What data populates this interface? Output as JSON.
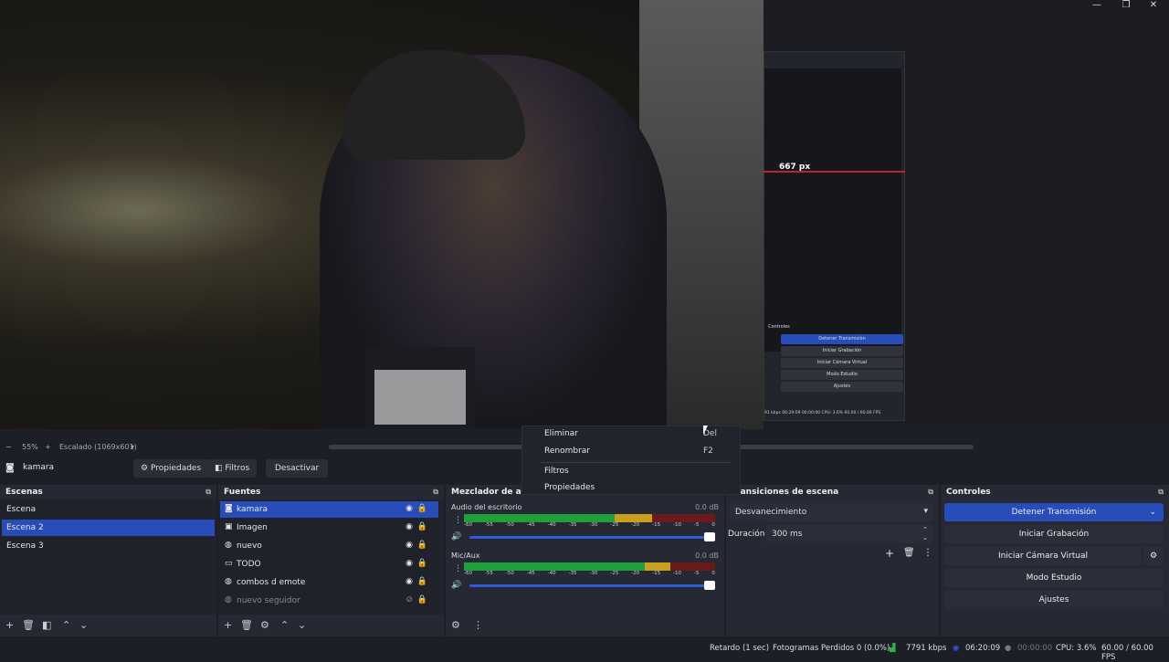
{
  "colors": {
    "accent": "#284cb8",
    "live_red": "#c0202f",
    "meter_green": "#1fa03a",
    "meter_yellow": "#c8a020",
    "meter_red": "#6a1a1a"
  },
  "preview_overlay": {
    "px_label": "667 px"
  },
  "mini_obs": {
    "controls_title": "Controles",
    "buttons": [
      "Detener Transmisión",
      "Iniciar Grabación",
      "Iniciar Cámara Virtual",
      "Modo Estudio",
      "Ajustes"
    ],
    "status": "91 kbps   06:29:09   00:00:00   CPU: 3.6%   60.00 / 60.00 FPS"
  },
  "zoombar": {
    "minus": "−",
    "zoom": "55%",
    "plus": "+",
    "scale": "Escalado (1069x601)",
    "caret": "▾"
  },
  "context_menu": {
    "items": [
      {
        "label": "Eliminar",
        "shortcut": "Del"
      },
      {
        "label": "Renombrar",
        "shortcut": "F2"
      },
      {
        "label": "Filtros",
        "shortcut": ""
      },
      {
        "label": "Propiedades",
        "shortcut": ""
      }
    ]
  },
  "source_toolbar": {
    "source_name": "kamara",
    "properties": "Propiedades",
    "filters": "Filtros",
    "deactivate": "Desactivar"
  },
  "scenes": {
    "title": "Escenas",
    "items": [
      "Escena",
      "Escena 2",
      "Escena 3"
    ],
    "selected_index": 1
  },
  "sources": {
    "title": "Fuentes",
    "items": [
      {
        "name": "kamara",
        "icon": "camera-icon",
        "visible": true
      },
      {
        "name": "Imagen",
        "icon": "image-icon",
        "visible": true
      },
      {
        "name": "nuevo",
        "icon": "globe-icon",
        "visible": true
      },
      {
        "name": "TODO",
        "icon": "monitor-icon",
        "visible": true
      },
      {
        "name": "combos d emote",
        "icon": "globe-icon",
        "visible": true
      },
      {
        "name": "nuevo seguidor",
        "icon": "globe-icon",
        "visible": false
      }
    ]
  },
  "mixer": {
    "title": "Mezclador de audio",
    "scale": [
      "-60",
      "-55",
      "-50",
      "-45",
      "-40",
      "-35",
      "-30",
      "-25",
      "-20",
      "-15",
      "-10",
      "-5",
      "0"
    ],
    "channels": [
      {
        "name": "Audio del escritorio",
        "db": "0.0 dB",
        "level": 0.6
      },
      {
        "name": "Mic/Aux",
        "db": "0.0 dB",
        "level": 0.72
      }
    ]
  },
  "transitions": {
    "title": "Transiciones de escena",
    "selected": "Desvanecimiento",
    "duration_label": "Duración",
    "duration_value": "300 ms"
  },
  "controls": {
    "title": "Controles",
    "buttons": [
      "Detener Transmisión",
      "Iniciar Grabación",
      "Iniciar Cámara Virtual",
      "Modo Estudio",
      "Ajustes"
    ]
  },
  "status": {
    "delay": "Retardo (1 sec)",
    "dropped": "Fotogramas Perdidos 0 (0.0%)",
    "bitrate": "7791 kbps",
    "stream_time": "06:20:09",
    "rec_time": "00:00:00",
    "cpu": "CPU: 3.6%",
    "fps": "60.00 / 60.00 FPS"
  }
}
